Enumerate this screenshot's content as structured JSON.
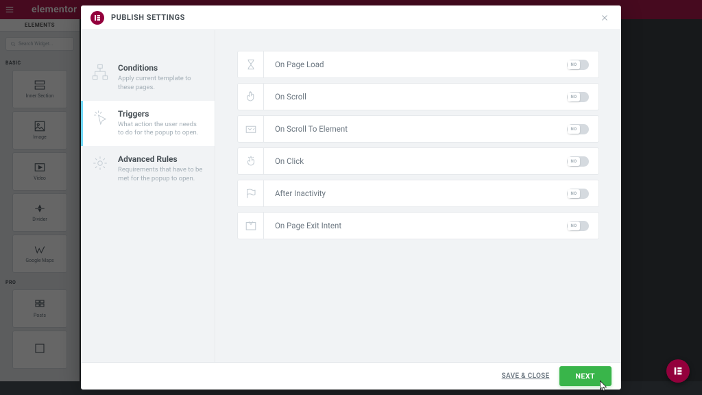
{
  "background": {
    "brand": "elementor",
    "panel_header": "ELEMENTS",
    "search_placeholder": "Search Widget...",
    "sections": [
      {
        "label": "BASIC",
        "widgets": [
          "Inner Section",
          "Image",
          "Video",
          "Divider",
          "Google Maps"
        ]
      },
      {
        "label": "PRO",
        "widgets": [
          "Posts",
          ""
        ]
      }
    ]
  },
  "modal": {
    "title": "PUBLISH SETTINGS"
  },
  "sidebar": [
    {
      "title": "Conditions",
      "desc": "Apply current template to these pages.",
      "icon": "sitemap",
      "active": false
    },
    {
      "title": "Triggers",
      "desc": "What action the user needs to do for the popup to open.",
      "icon": "pointer-click",
      "active": true
    },
    {
      "title": "Advanced Rules",
      "desc": "Requirements that have to be met for the popup to open.",
      "icon": "gear",
      "active": false
    }
  ],
  "triggers": [
    {
      "label": "On Page Load",
      "icon": "hourglass",
      "enabled": false
    },
    {
      "label": "On Scroll",
      "icon": "hand-scroll",
      "enabled": false
    },
    {
      "label": "On Scroll To Element",
      "icon": "element-target",
      "enabled": false
    },
    {
      "label": "On Click",
      "icon": "finger-click",
      "enabled": false
    },
    {
      "label": "After Inactivity",
      "icon": "flag",
      "enabled": false
    },
    {
      "label": "On Page Exit Intent",
      "icon": "cursor-exit",
      "enabled": false
    }
  ],
  "toggle_off_label": "NO",
  "footer": {
    "save_close": "SAVE & CLOSE",
    "next": "NEXT"
  }
}
